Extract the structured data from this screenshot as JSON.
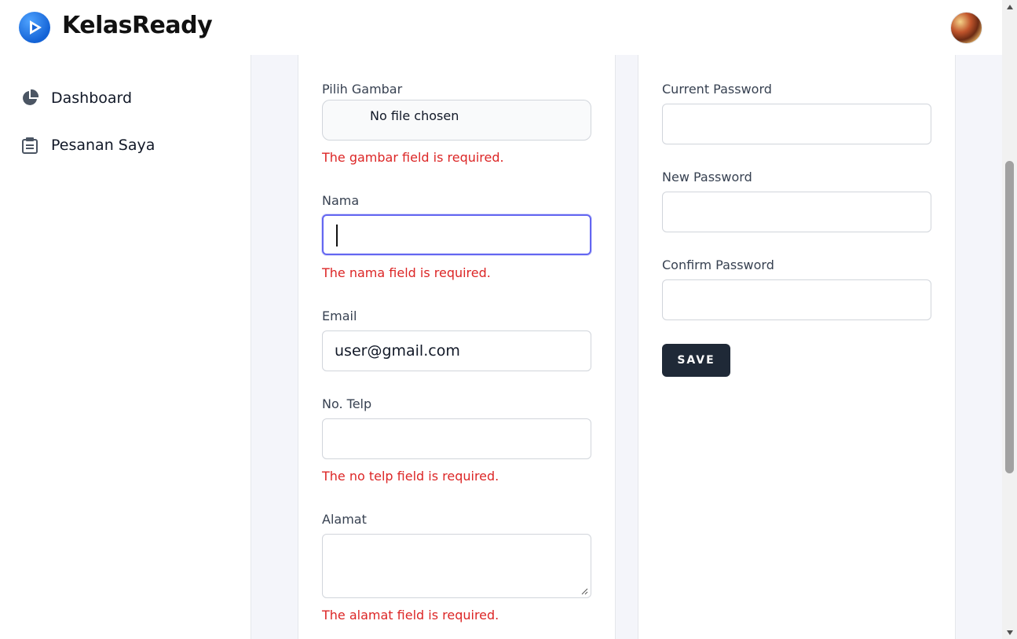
{
  "header": {
    "brand": "KelasReady",
    "logo_icon": "play-logo-icon",
    "avatar_icon": "user-avatar"
  },
  "sidebar": {
    "items": [
      {
        "label": "Dashboard",
        "icon": "pie-chart-icon"
      },
      {
        "label": "Pesanan Saya",
        "icon": "clipboard-icon"
      }
    ]
  },
  "profile_form": {
    "gambar_label": "Pilih Gambar",
    "file_status": "No file chosen",
    "gambar_error": "The gambar field is required.",
    "nama_label": "Nama",
    "nama_value": "",
    "nama_error": "The nama field is required.",
    "email_label": "Email",
    "email_value": "user@gmail.com",
    "telp_label": "No. Telp",
    "telp_value": "",
    "telp_error": "The no telp field is required.",
    "alamat_label": "Alamat",
    "alamat_error": "The alamat field is required."
  },
  "password_form": {
    "current_label": "Current Password",
    "new_label": "New Password",
    "confirm_label": "Confirm Password",
    "save_label": "SAVE"
  },
  "colors": {
    "accent": "#6366f1",
    "error": "#dc2626",
    "button": "#1f2937",
    "page_bg": "#f4f5fa"
  }
}
